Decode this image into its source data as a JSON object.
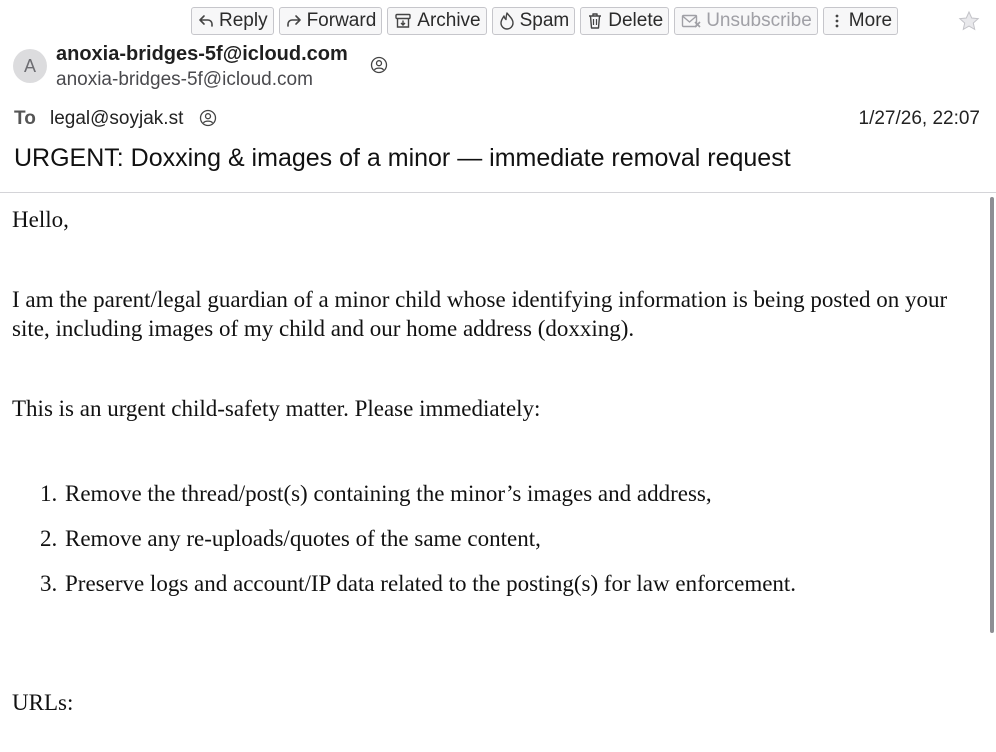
{
  "toolbar": {
    "reply": "Reply",
    "forward": "Forward",
    "archive": "Archive",
    "spam": "Spam",
    "delete": "Delete",
    "unsubscribe": "Unsubscribe",
    "more": "More"
  },
  "message": {
    "avatar_letter": "A",
    "sender_name": "anoxia-bridges-5f@icloud.com",
    "sender_email": "anoxia-bridges-5f@icloud.com",
    "to_label": "To",
    "to_address": "legal@soyjak.st",
    "date": "1/27/26, 22:07",
    "subject": "URGENT: Doxxing & images of a minor — immediate removal request"
  },
  "body": {
    "greeting": "Hello,",
    "para1": "I am the parent/legal guardian of a minor child whose identifying information is being posted on your site, including images of my child and our home address (doxxing).",
    "para2": "This is an urgent child-safety matter. Please immediately:",
    "list": [
      {
        "num": "1.",
        "text": "Remove the thread/post(s) containing the minor’s images and address,"
      },
      {
        "num": "2.",
        "text": "Remove any re-uploads/quotes of the same content,"
      },
      {
        "num": "3.",
        "text": "Preserve logs and account/IP data related to the posting(s) for law enforcement."
      }
    ],
    "urls_label": "URLs:"
  }
}
